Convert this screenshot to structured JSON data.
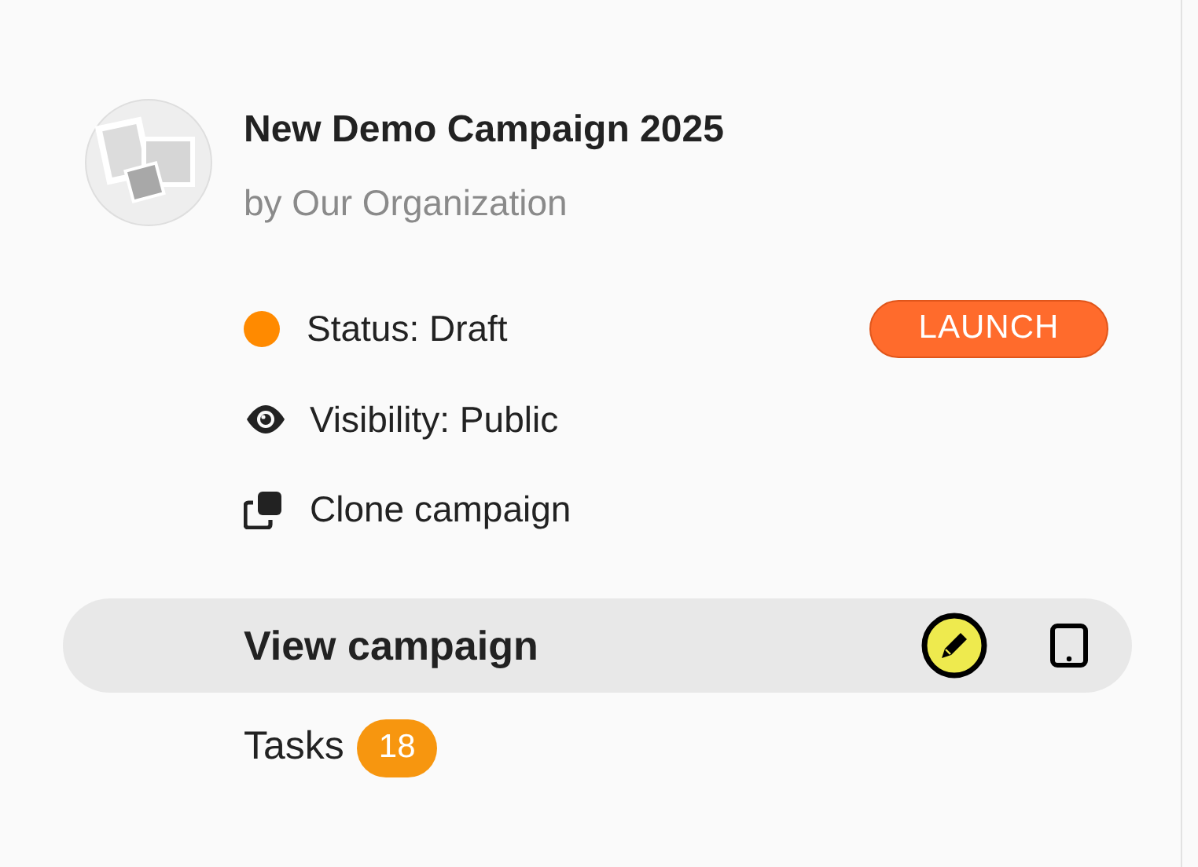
{
  "campaign": {
    "title": "New Demo Campaign 2025",
    "organization": "by Our Organization"
  },
  "status": {
    "label": "Status: Draft",
    "color": "#ff8a00"
  },
  "launch_button": "LAUNCH",
  "visibility": "Visibility: Public",
  "clone": "Clone campaign",
  "nav": [
    {
      "label": "View campaign",
      "selected": true,
      "kind": "view"
    },
    {
      "label": "Tasks",
      "badge": "18",
      "selected": false,
      "kind": "tasks"
    }
  ]
}
